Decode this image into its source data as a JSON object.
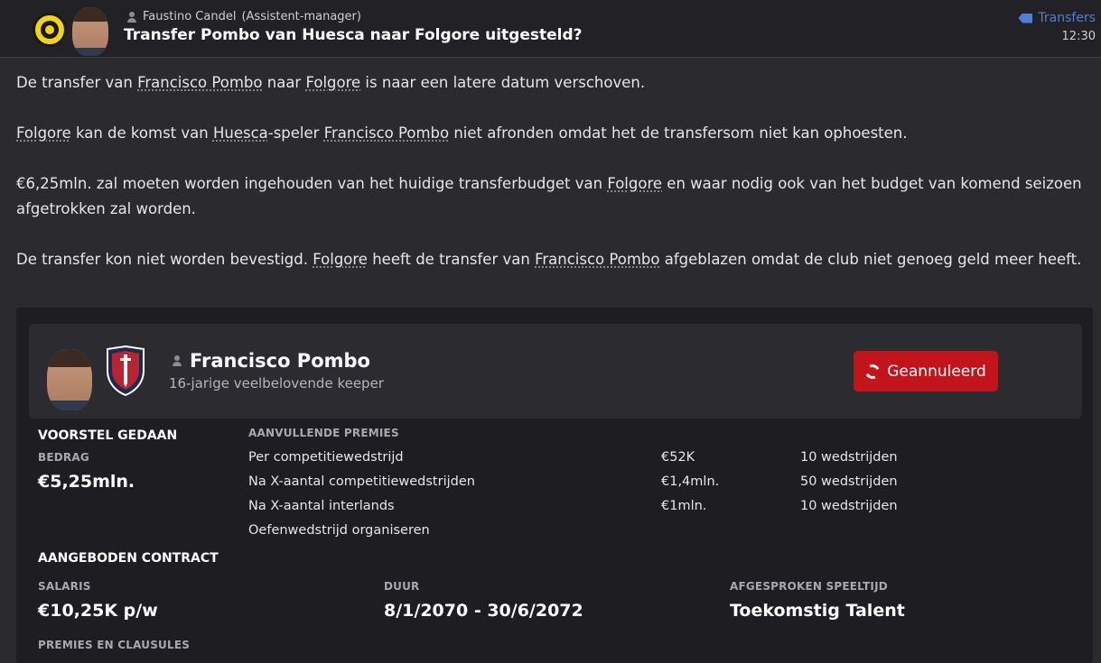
{
  "header": {
    "sender_name": "Faustino Candel",
    "sender_role": "(Assistent-manager)",
    "subject": "Transfer Pombo van Huesca naar Folgore uitgesteld?",
    "category": "Transfers",
    "time": "12:30"
  },
  "message": {
    "p1": {
      "t1": "De transfer van ",
      "l1": "Francisco Pombo",
      "t2": " naar ",
      "l2": "Folgore",
      "t3": " is naar een latere datum verschoven."
    },
    "p2": {
      "l1": "Folgore",
      "t1": " kan de komst van ",
      "l2": "Huesca",
      "t2": "-speler ",
      "l3": "Francisco Pombo",
      "t3": " niet afronden omdat het de transfersom niet kan ophoesten."
    },
    "p3": {
      "t1": "€6,25mln. zal moeten worden ingehouden van het huidige transferbudget van ",
      "l1": "Folgore",
      "t2": " en waar nodig ook van het budget van komend seizoen afgetrokken zal worden."
    },
    "p4": {
      "t1": "De transfer kon niet worden bevestigd. ",
      "l1": "Folgore",
      "t2": " heeft de transfer van ",
      "l2": "Francisco Pombo",
      "t3": " afgeblazen omdat de club niet genoeg geld meer heeft."
    }
  },
  "player": {
    "name": "Francisco Pombo",
    "description": "16-jarige veelbelovende keeper",
    "status_button": "Geannuleerd"
  },
  "offer": {
    "heading": "VOORSTEL GEDAAN",
    "amount_label": "BEDRAG",
    "amount": "€5,25mln.",
    "bonuses_label": "AANVULLENDE PREMIES",
    "bonuses": [
      {
        "name": "Per competitiewedstrijd",
        "value": "€52K",
        "condition": "10 wedstrijden"
      },
      {
        "name": "Na X-aantal competitiewedstrijden",
        "value": "€1,4mln.",
        "condition": "50 wedstrijden"
      },
      {
        "name": "Na X-aantal interlands",
        "value": "€1mln.",
        "condition": "10 wedstrijden"
      },
      {
        "name": "Oefenwedstrijd organiseren",
        "value": "",
        "condition": ""
      }
    ]
  },
  "contract": {
    "heading": "AANGEBODEN CONTRACT",
    "salary_label": "SALARIS",
    "salary": "€10,25K p/w",
    "duration_label": "DUUR",
    "duration": "8/1/2070 - 30/6/2072",
    "playtime_label": "AFGESPROKEN SPEELTIJD",
    "playtime": "Toekomstig Talent",
    "clauses_label": "PREMIES EN CLAUSULES"
  },
  "colors": {
    "accent_blue": "#4f7fd4",
    "cancel_red": "#c4141b",
    "club_yellow": "#f2d21a"
  }
}
